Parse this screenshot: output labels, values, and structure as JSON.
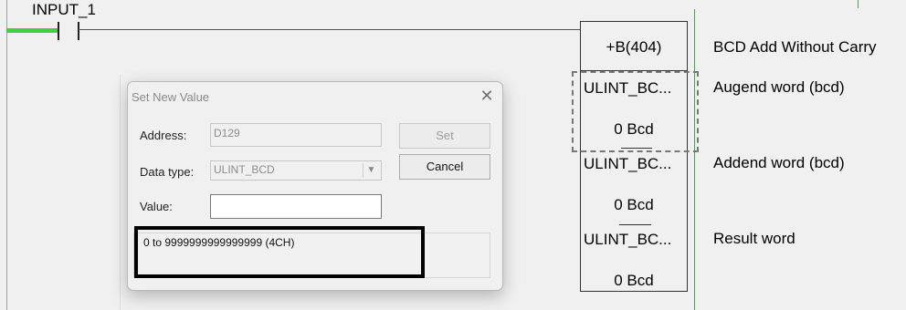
{
  "ladder": {
    "contact_label": "INPUT_1",
    "instruction": "+B(404)",
    "description": "BCD Add Without Carry",
    "operands": [
      {
        "type": "ULINT_BC...",
        "value": "0 Bcd",
        "desc": "Augend word (bcd)"
      },
      {
        "type": "ULINT_BC...",
        "value": "0 Bcd",
        "desc": "Addend word (bcd)"
      },
      {
        "type": "ULINT_BC...",
        "value": "0 Bcd",
        "desc": "Result word"
      }
    ]
  },
  "dialog": {
    "title": "Set New Value",
    "address_label": "Address:",
    "address_value": "D129",
    "datatype_label": "Data type:",
    "datatype_value": "ULINT_BCD",
    "value_label": "Value:",
    "value_input": "",
    "set_button": "Set",
    "cancel_button": "Cancel",
    "range_text": "0 to 9999999999999999 (4CH)"
  },
  "icons": {
    "close": "close-icon",
    "dropdown": "chevron-down-icon"
  },
  "colors": {
    "power_flow": "#3fd23f",
    "rail": "#5a985a",
    "highlight": "#000000"
  }
}
